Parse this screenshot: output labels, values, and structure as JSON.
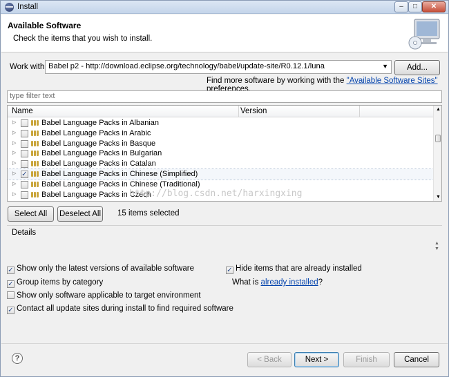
{
  "window": {
    "title": "Install"
  },
  "header": {
    "title": "Available Software",
    "subtitle": "Check the items that you wish to install."
  },
  "work_with": {
    "label": "Work with:",
    "value": "Babel p2 - http://download.eclipse.org/technology/babel/update-site/R0.12.1/luna",
    "add_button": "Add...",
    "find_more_prefix": "Find more software by working with the ",
    "find_more_link": "\"Available Software Sites\"",
    "find_more_suffix": " preferences."
  },
  "filter": {
    "placeholder": "type filter text"
  },
  "table": {
    "columns": [
      "Name",
      "Version"
    ],
    "rows": [
      {
        "label": "Babel Language Packs in Albanian",
        "checked": false
      },
      {
        "label": "Babel Language Packs in Arabic",
        "checked": false
      },
      {
        "label": "Babel Language Packs in Basque",
        "checked": false
      },
      {
        "label": "Babel Language Packs in Bulgarian",
        "checked": false
      },
      {
        "label": "Babel Language Packs in Catalan",
        "checked": false
      },
      {
        "label": "Babel Language Packs in Chinese (Simplified)",
        "checked": true
      },
      {
        "label": "Babel Language Packs in Chinese (Traditional)",
        "checked": false
      },
      {
        "label": "Babel Language Packs in Czech",
        "checked": false
      }
    ]
  },
  "watermark": "http://blog.csdn.net/harxingxing",
  "selection": {
    "select_all": "Select All",
    "deselect_all": "Deselect All",
    "count_text": "15 items selected"
  },
  "details": {
    "label": "Details"
  },
  "options": {
    "latest_versions": {
      "label": "Show only the latest versions of available software",
      "checked": true
    },
    "group_by_category": {
      "label": "Group items by category",
      "checked": true
    },
    "target_env": {
      "label": "Show only software applicable to target environment",
      "checked": false
    },
    "contact_sites": {
      "label": "Contact all update sites during install to find required software",
      "checked": true
    },
    "hide_installed": {
      "label": "Hide items that are already installed",
      "checked": true
    },
    "what_is_prefix": "What is ",
    "what_is_link": "already installed",
    "what_is_suffix": "?"
  },
  "footer": {
    "back": "< Back",
    "next": "Next >",
    "finish": "Finish",
    "cancel": "Cancel"
  },
  "icons": {
    "app": "eclipse-icon",
    "banner": "install-computer-icon",
    "help": "help-icon"
  }
}
